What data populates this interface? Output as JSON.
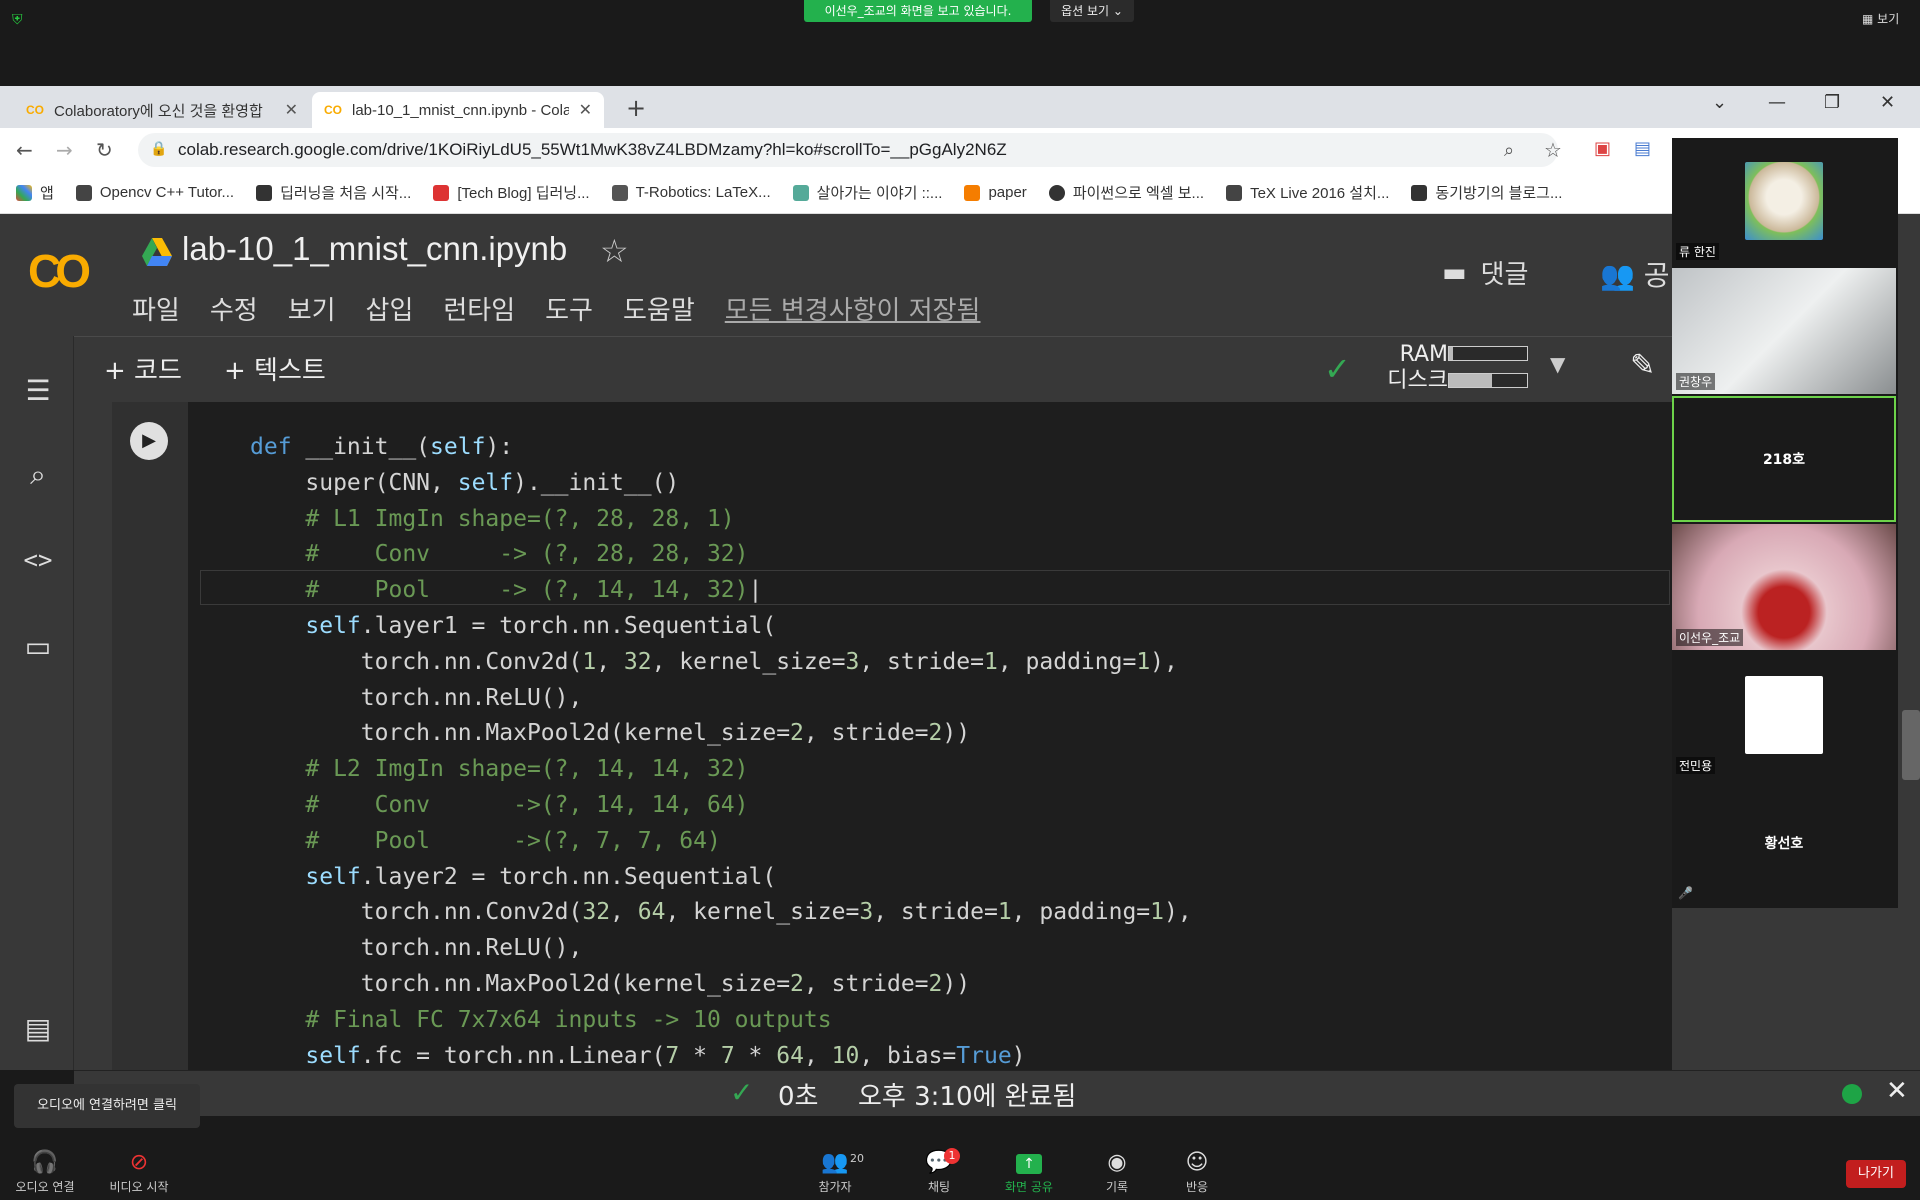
{
  "zoom": {
    "share_banner": "이선우_조교의 화면을 보고 있습니다.",
    "view_options": "옵션 보기 ⌄",
    "view_button": "▦ 보기",
    "audio_tooltip": "오디오에 연결하려면 클릭",
    "bottom_buttons": {
      "audio": "오디오 연결",
      "video": "비디오 시작",
      "participants": "참가자",
      "participants_count": "20",
      "chat": "채팅",
      "chat_badge": "1",
      "share": "화면 공유",
      "record": "기록",
      "reactions": "반응",
      "leave": "나가기"
    },
    "participants": [
      {
        "name": "류 한진",
        "type": "avatar-dog"
      },
      {
        "name": "권창우",
        "type": "video"
      },
      {
        "name": "218호",
        "type": "text",
        "active": true
      },
      {
        "name": "이선우_조교",
        "type": "video"
      },
      {
        "name": "전민용",
        "type": "avatar-white"
      },
      {
        "name": "황선호",
        "type": "text"
      }
    ]
  },
  "browser": {
    "tabs": [
      {
        "title": "Colaboratory에 오신 것을 환영합",
        "active": false
      },
      {
        "title": "lab-10_1_mnist_cnn.ipynb - Cola",
        "active": true
      }
    ],
    "url": "colab.research.google.com/drive/1KOiRiyLdU5_55Wt1MwK38vZ4LBDMzamy?hl=ko#scrollTo=__pGgAly2N6Z",
    "bookmarks": [
      {
        "label": "앱",
        "color": "#e04a3f"
      },
      {
        "label": "Opencv C++ Tutor...",
        "color": "#444"
      },
      {
        "label": "딥러닝을 처음 시작...",
        "color": "#333"
      },
      {
        "label": "[Tech Blog] 딥러닝...",
        "color": "#d33"
      },
      {
        "label": "T-Robotics: LaTeX...",
        "color": "#555"
      },
      {
        "label": "살아가는 이야기 ::...",
        "color": "#5a9"
      },
      {
        "label": "paper",
        "color": "#f57d00"
      },
      {
        "label": "파이썬으로 엑셀 보...",
        "color": "#333"
      },
      {
        "label": "TeX Live 2016 설치...",
        "color": "#444"
      },
      {
        "label": "동기방기의 블로그...",
        "color": "#333"
      }
    ]
  },
  "colab": {
    "notebook_title": "lab-10_1_mnist_cnn.ipynb",
    "menu": [
      "파일",
      "수정",
      "보기",
      "삽입",
      "런타임",
      "도구",
      "도움말"
    ],
    "saved_note": "모든 변경사항이 저장됨",
    "comment_label": "댓글",
    "share_label": "공",
    "add_code": "+ 코드",
    "add_text": "+ 텍스트",
    "ram_label": "RAM",
    "disk_label": "디스크",
    "ram_usage": 0.05,
    "disk_usage": 0.55,
    "status_time": "0초",
    "status_done": "오후 3:10에 완료됨"
  }
}
